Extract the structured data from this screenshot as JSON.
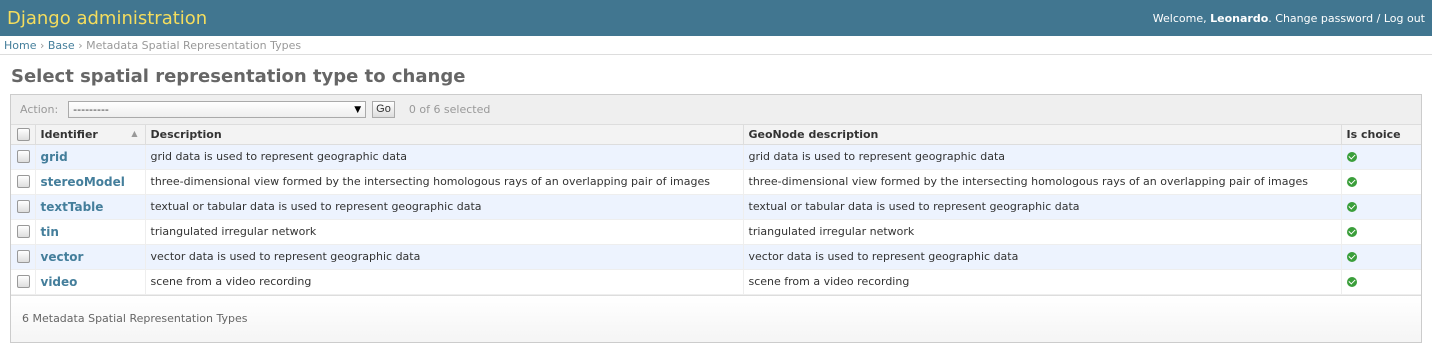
{
  "header": {
    "site_name": "Django administration",
    "welcome": "Welcome,",
    "username": "Leonardo",
    "change_password": "Change password",
    "separator": "/",
    "logout": "Log out"
  },
  "breadcrumbs": {
    "home": "Home",
    "app": "Base",
    "current": "Metadata Spatial Representation Types",
    "sep": "›"
  },
  "page_title": "Select spatial representation type to change",
  "actions": {
    "label": "Action:",
    "selected_option": "---------",
    "go_label": "Go",
    "counter": "0 of 6 selected"
  },
  "table": {
    "headers": {
      "identifier": "Identifier",
      "description": "Description",
      "geonode_description": "GeoNode description",
      "is_choice": "Is choice"
    },
    "rows": [
      {
        "identifier": "grid",
        "description": "grid data is used to represent geographic data",
        "geonode_description": "grid data is used to represent geographic data",
        "is_choice": true
      },
      {
        "identifier": "stereoModel",
        "description": "three-dimensional view formed by the intersecting homologous rays of an overlapping pair of images",
        "geonode_description": "three-dimensional view formed by the intersecting homologous rays of an overlapping pair of images",
        "is_choice": true
      },
      {
        "identifier": "textTable",
        "description": "textual or tabular data is used to represent geographic data",
        "geonode_description": "textual or tabular data is used to represent geographic data",
        "is_choice": true
      },
      {
        "identifier": "tin",
        "description": "triangulated irregular network",
        "geonode_description": "triangulated irregular network",
        "is_choice": true
      },
      {
        "identifier": "vector",
        "description": "vector data is used to represent geographic data",
        "geonode_description": "vector data is used to represent geographic data",
        "is_choice": true
      },
      {
        "identifier": "video",
        "description": "scene from a video recording",
        "geonode_description": "scene from a video recording",
        "is_choice": true
      }
    ]
  },
  "paginator": "6 Metadata Spatial Representation Types",
  "colors": {
    "header_bg": "#417690",
    "brand": "#f5dd5d",
    "link": "#447e9b",
    "row_alt": "#edf3fe",
    "yes_icon": "#3a9e3a"
  },
  "icons": {
    "sort": "sort-ascending-icon",
    "select_arrow": "chevron-down-icon",
    "yes": "check-circle-icon"
  }
}
